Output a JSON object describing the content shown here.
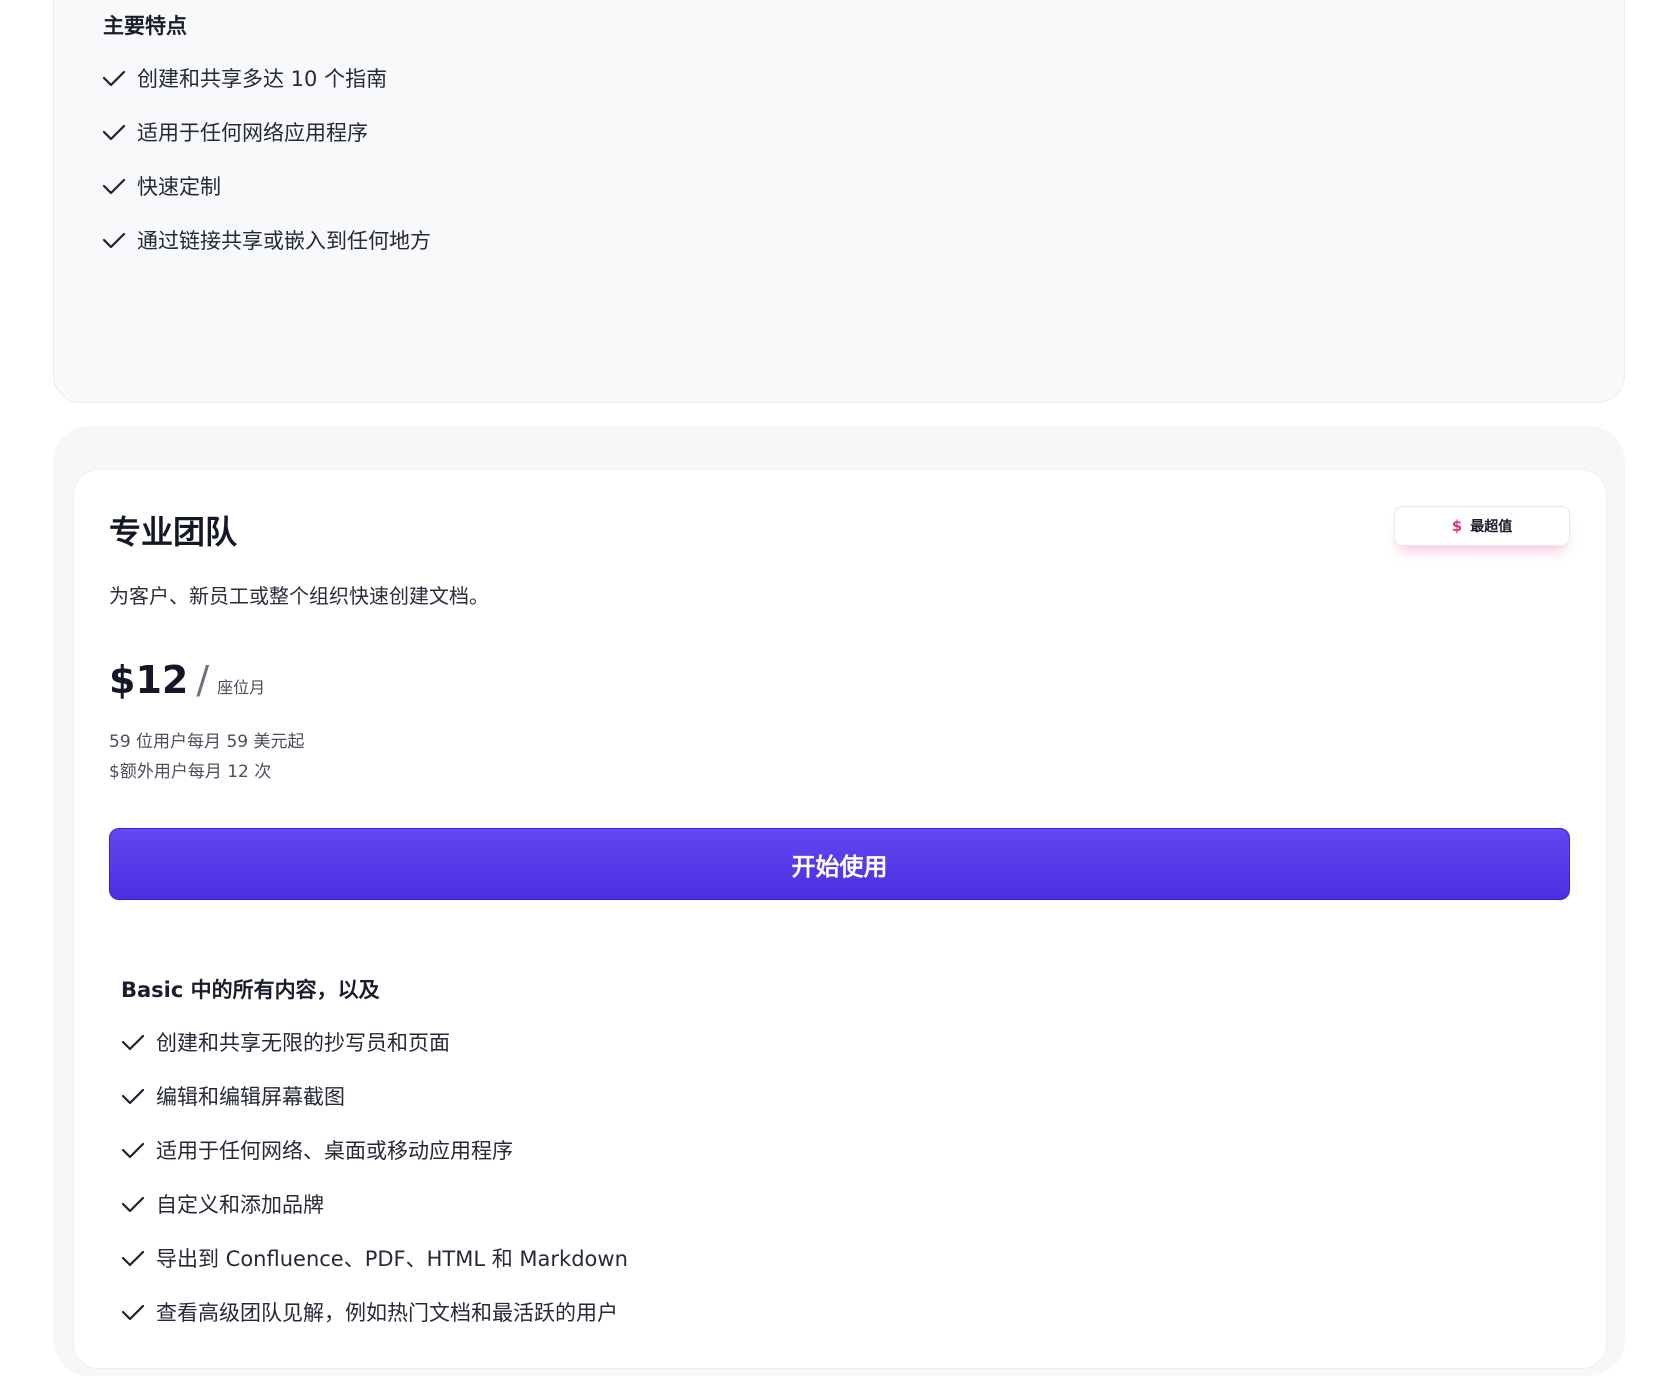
{
  "basic_card": {
    "features_title": "主要特点",
    "features": [
      "创建和共享多达 10 个指南",
      "适用于任何网络应用程序",
      "快速定制",
      "通过链接共享或嵌入到任何地方"
    ]
  },
  "pro_card": {
    "title": "专业团队",
    "badge": {
      "icon": "dollar-icon",
      "symbol": "$",
      "label": "最超值",
      "accent_color": "#e0328a"
    },
    "description": "为客户、新员工或整个组织快速创建文档。",
    "price": "$12",
    "price_separator": "/",
    "price_unit": "座位月",
    "note_1": "59 位用户每月 59 美元起",
    "note_2": "$额外用户每月 12 次",
    "cta_label": "开始使用",
    "cta_color": "#5535e8",
    "features_title": "Basic 中的所有内容，以及",
    "features": [
      "创建和共享无限的抄写员和页面",
      "编辑和编辑屏幕截图",
      "适用于任何网络、桌面或移动应用程序",
      "自定义和添加品牌",
      "导出到 Confluence、PDF、HTML 和 Markdown",
      "查看高级团队见解，例如热门文档和最活跃的用户"
    ]
  }
}
